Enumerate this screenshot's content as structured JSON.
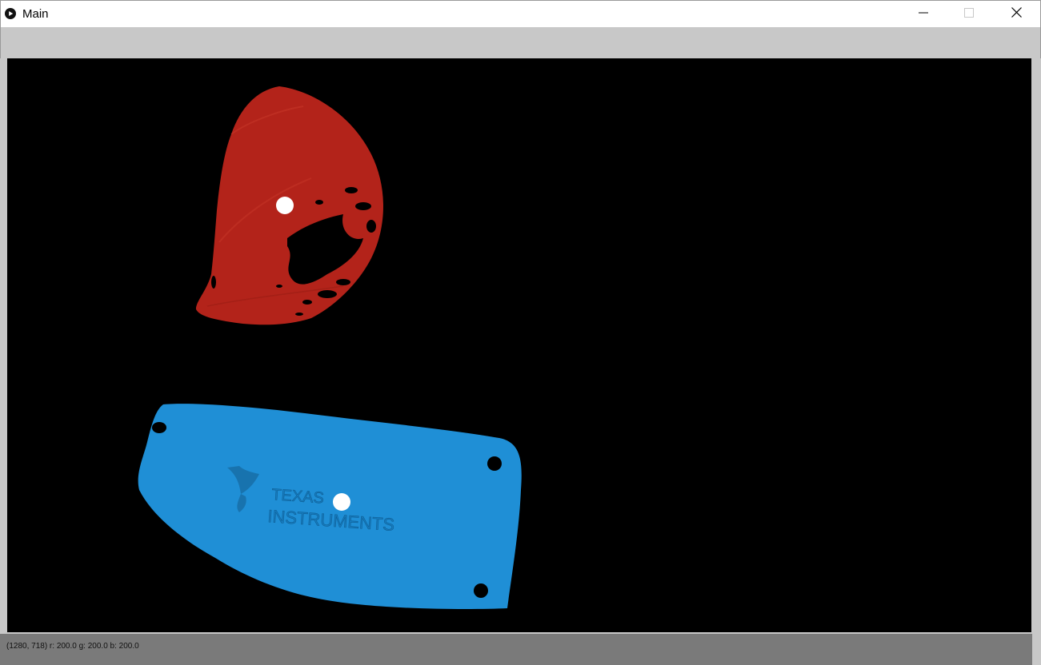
{
  "window": {
    "title": "Main",
    "icon": "play-circle-icon",
    "controls": [
      "minimize-icon",
      "maximize-icon",
      "close-icon"
    ]
  },
  "canvas": {
    "background": "#000000",
    "blobs": [
      {
        "name": "red-blob",
        "color": "#b3231a",
        "centroid_marker": "white-dot"
      },
      {
        "name": "blue-blob",
        "color": "#1f8fd6",
        "centroid_marker": "white-dot",
        "embossed_text": [
          "TEXAS",
          "INSTRUMENTS"
        ]
      }
    ]
  },
  "status": {
    "text": "(1280, 718) r: 200.0 g: 200.0 b: 200.0"
  },
  "colors": {
    "frame": "#c8c8c8",
    "status_bar": "#7a7a7a"
  }
}
